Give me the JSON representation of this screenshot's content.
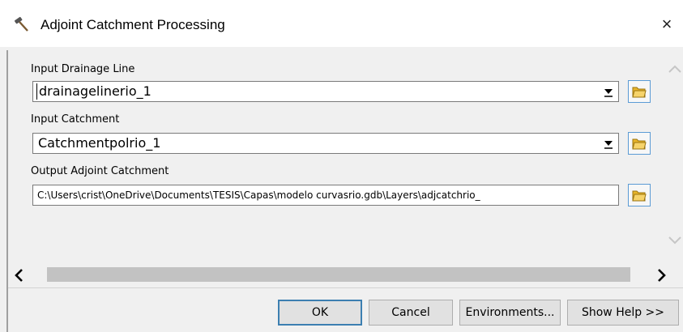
{
  "window": {
    "title": "Adjoint Catchment Processing",
    "close_glyph": "×",
    "icon": "hammer-icon"
  },
  "fields": {
    "drainage": {
      "label": "Input Drainage Line",
      "value": "drainagelinerio_1"
    },
    "catchment": {
      "label": "Input Catchment",
      "value": "Catchmentpolrio_1"
    },
    "output": {
      "label": "Output Adjoint Catchment",
      "value": "C:\\Users\\crist\\OneDrive\\Documents\\TESIS\\Capas\\modelo curvasrio.gdb\\Layers\\adjcatchrio_"
    }
  },
  "buttons": {
    "ok": "OK",
    "cancel": "Cancel",
    "environments": "Environments...",
    "help": "Show Help >>"
  },
  "colors": {
    "accent": "#3c7fb1",
    "folder": "#e8b52a"
  }
}
